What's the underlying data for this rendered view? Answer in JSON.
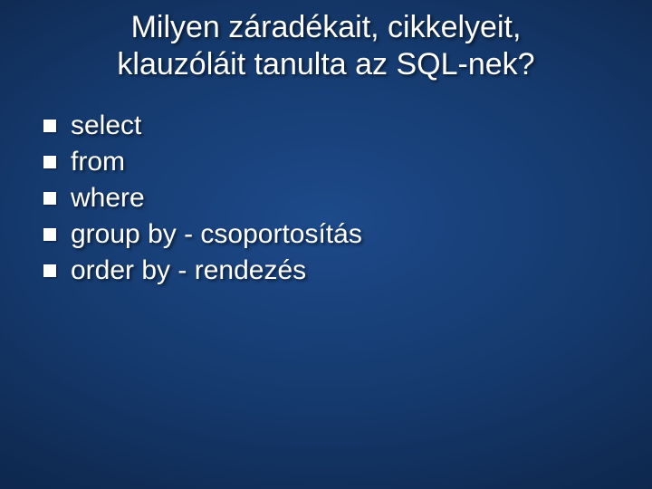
{
  "title_line1": "Milyen záradékait, cikkelyeit,",
  "title_line2": "klauzóláit tanulta az SQL-nek?",
  "items": [
    "select",
    "from",
    "where",
    "group by - csoportosítás",
    "order by - rendezés"
  ]
}
